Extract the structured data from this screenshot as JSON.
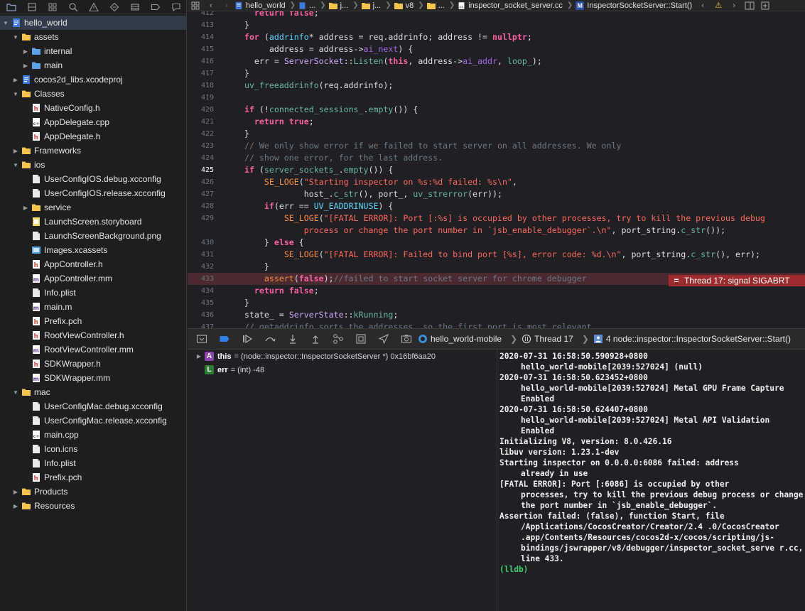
{
  "navigator": {
    "toolbar_icons": [
      "folder-icon",
      "source-control-icon",
      "symbol-icon",
      "find-icon",
      "issue-icon",
      "test-icon",
      "debug-icon",
      "breakpoint-icon",
      "report-icon"
    ],
    "tree": [
      {
        "label": "hello_world",
        "indent": 0,
        "icon": "project",
        "disclosure": "open",
        "selected": true
      },
      {
        "label": "assets",
        "indent": 1,
        "icon": "folder",
        "disclosure": "open"
      },
      {
        "label": "internal",
        "indent": 2,
        "icon": "folder-blue",
        "disclosure": "closed"
      },
      {
        "label": "main",
        "indent": 2,
        "icon": "folder-blue",
        "disclosure": "closed"
      },
      {
        "label": "cocos2d_libs.xcodeproj",
        "indent": 1,
        "icon": "project",
        "disclosure": "closed"
      },
      {
        "label": "Classes",
        "indent": 1,
        "icon": "folder",
        "disclosure": "open"
      },
      {
        "label": "NativeConfig.h",
        "indent": 2,
        "icon": "h"
      },
      {
        "label": "AppDelegate.cpp",
        "indent": 2,
        "icon": "cpp"
      },
      {
        "label": "AppDelegate.h",
        "indent": 2,
        "icon": "h"
      },
      {
        "label": "Frameworks",
        "indent": 1,
        "icon": "folder",
        "disclosure": "closed"
      },
      {
        "label": "ios",
        "indent": 1,
        "icon": "folder",
        "disclosure": "open"
      },
      {
        "label": "UserConfigIOS.debug.xcconfig",
        "indent": 2,
        "icon": "doc"
      },
      {
        "label": "UserConfigIOS.release.xcconfig",
        "indent": 2,
        "icon": "doc"
      },
      {
        "label": "service",
        "indent": 2,
        "icon": "folder",
        "disclosure": "closed"
      },
      {
        "label": "LaunchScreen.storyboard",
        "indent": 2,
        "icon": "storyboard"
      },
      {
        "label": "LaunchScreenBackground.png",
        "indent": 2,
        "icon": "doc"
      },
      {
        "label": "Images.xcassets",
        "indent": 2,
        "icon": "assets"
      },
      {
        "label": "AppController.h",
        "indent": 2,
        "icon": "h"
      },
      {
        "label": "AppController.mm",
        "indent": 2,
        "icon": "m"
      },
      {
        "label": "Info.plist",
        "indent": 2,
        "icon": "doc"
      },
      {
        "label": "main.m",
        "indent": 2,
        "icon": "m"
      },
      {
        "label": "Prefix.pch",
        "indent": 2,
        "icon": "h"
      },
      {
        "label": "RootViewController.h",
        "indent": 2,
        "icon": "h"
      },
      {
        "label": "RootViewController.mm",
        "indent": 2,
        "icon": "m"
      },
      {
        "label": "SDKWrapper.h",
        "indent": 2,
        "icon": "h"
      },
      {
        "label": "SDKWrapper.mm",
        "indent": 2,
        "icon": "m"
      },
      {
        "label": "mac",
        "indent": 1,
        "icon": "folder",
        "disclosure": "open"
      },
      {
        "label": "UserConfigMac.debug.xcconfig",
        "indent": 2,
        "icon": "doc"
      },
      {
        "label": "UserConfigMac.release.xcconfig",
        "indent": 2,
        "icon": "doc"
      },
      {
        "label": "main.cpp",
        "indent": 2,
        "icon": "cpp"
      },
      {
        "label": "Icon.icns",
        "indent": 2,
        "icon": "doc"
      },
      {
        "label": "Info.plist",
        "indent": 2,
        "icon": "doc"
      },
      {
        "label": "Prefix.pch",
        "indent": 2,
        "icon": "h"
      },
      {
        "label": "Products",
        "indent": 1,
        "icon": "folder",
        "disclosure": "closed"
      },
      {
        "label": "Resources",
        "indent": 1,
        "icon": "folder",
        "disclosure": "closed"
      }
    ]
  },
  "jumpbar": {
    "crumbs": [
      "hello_world",
      "...",
      "j...",
      "j...",
      "v8",
      "...",
      "inspector_socket_server.cc",
      "InspectorSocketServer::Start()"
    ],
    "method_badge": "M"
  },
  "editor": {
    "lines": [
      {
        "n": "412",
        "html": "    <span class=\"kw\">return</span> <span class=\"kw\">false</span>;"
      },
      {
        "n": "413",
        "html": "  }"
      },
      {
        "n": "414",
        "html": "  <span class=\"kw\">for</span> (<span class=\"type\">addrinfo</span>* address = req.addrinfo; address != <span class=\"kw\">nullptr</span>;"
      },
      {
        "n": "415",
        "html": "       address = address-><span class=\"mem\">ai_next</span>) {"
      },
      {
        "n": "416",
        "html": "    err = <span class=\"cls\">ServerSocket</span>::<span class=\"fn\">Listen</span>(<span class=\"kw\">this</span>, address-><span class=\"mem\">ai_addr</span>, <span class=\"fn\">loop_</span>);"
      },
      {
        "n": "417",
        "html": "  }"
      },
      {
        "n": "418",
        "html": "  <span class=\"fn\">uv_freeaddrinfo</span>(req.addrinfo);"
      },
      {
        "n": "419",
        "html": ""
      },
      {
        "n": "420",
        "html": "  <span class=\"kw\">if</span> (!<span class=\"fn\">connected_sessions_</span>.<span class=\"fn\">empty</span>()) {"
      },
      {
        "n": "421",
        "html": "    <span class=\"kw\">return</span> <span class=\"kw\">true</span>;"
      },
      {
        "n": "422",
        "html": "  }"
      },
      {
        "n": "423",
        "html": "  <span class=\"cmt\">// We only show error if we failed to start server on all addresses. We only</span>"
      },
      {
        "n": "424",
        "html": "  <span class=\"cmt\">// show one error, for the last address.</span>"
      },
      {
        "n": "425",
        "html": "  <span class=\"kw\">if</span> (<span class=\"fn\">server_sockets_</span>.<span class=\"fn\">empty</span>()) {",
        "current": true
      },
      {
        "n": "426",
        "html": "      <span class=\"macro\">SE_LOGE</span>(<span class=\"str\">\"Starting inspector on %s:%d failed: %s\\n\"</span>,"
      },
      {
        "n": "427",
        "html": "              host_.<span class=\"fn\">c_str</span>(), port_, <span class=\"fn\">uv_strerror</span>(err));"
      },
      {
        "n": "428",
        "html": "      <span class=\"kw\">if</span>(err == <span class=\"type\">UV_EADDRINUSE</span>) {"
      },
      {
        "n": "429",
        "html": "          <span class=\"macro\">SE_LOGE</span>(<span class=\"str\">\"[FATAL ERROR]: Port [:%s] is occupied by other processes, try to kill the previous debug</span>"
      },
      {
        "n": "",
        "html": "              <span class=\"str\">process or change the port number in `jsb_enable_debugger`.\\n\"</span>, port_string.<span class=\"fn\">c_str</span>());"
      },
      {
        "n": "430",
        "html": "      } <span class=\"kw\">else</span> {"
      },
      {
        "n": "431",
        "html": "          <span class=\"macro\">SE_LOGE</span>(<span class=\"str\">\"[FATAL ERROR]: Failed to bind port [%s], error code: %d.\\n\"</span>, port_string.<span class=\"fn\">c_str</span>(), err);"
      },
      {
        "n": "432",
        "html": "      }"
      },
      {
        "n": "433",
        "html": "      <span class=\"macro\">assert</span>(<span class=\"kw\">false</span>);<span class=\"cmt\">//failed to start socket server for chrome debugger</span>",
        "highlight": true
      },
      {
        "n": "434",
        "html": "    <span class=\"kw\">return</span> <span class=\"kw\">false</span>;"
      },
      {
        "n": "435",
        "html": "  }"
      },
      {
        "n": "436",
        "html": "  state_ = <span class=\"cls\">ServerState</span>::<span class=\"fn\">kRunning</span>;"
      },
      {
        "n": "437",
        "html": "  <span class=\"cmt\">// getaddrinfo sorts the addresses, so the first port is most relevant.</span>"
      }
    ],
    "signal_badge": "Thread 17: signal SIGABRT"
  },
  "debugbar": {
    "process": "hello_world-mobile",
    "thread": "Thread 17",
    "frame": "4 node::inspector::InspectorSocketServer::Start()"
  },
  "variables": [
    {
      "badge": "A",
      "badge_color": "#8e44ad",
      "name": "this",
      "value": "= (node::inspector::InspectorSocketServer *) 0x16bf6aa20",
      "expandable": true
    },
    {
      "badge": "L",
      "badge_color": "#2e7d32",
      "name": "err",
      "value": "= (int) -48",
      "expandable": false
    }
  ],
  "console": {
    "lines": [
      {
        "t": "2020-07-31 16:58:50.590928+0800",
        "indent": false
      },
      {
        "t": "hello_world-mobile[2039:527024] (null)",
        "indent": true
      },
      {
        "t": "2020-07-31 16:58:50.623452+0800",
        "indent": false
      },
      {
        "t": "hello_world-mobile[2039:527024] Metal GPU Frame Capture Enabled",
        "indent": true
      },
      {
        "t": "2020-07-31 16:58:50.624407+0800",
        "indent": false
      },
      {
        "t": "hello_world-mobile[2039:527024] Metal API Validation Enabled",
        "indent": true
      },
      {
        "t": "Initializing V8, version: 8.0.426.16",
        "indent": false
      },
      {
        "t": "libuv version: 1.23.1-dev",
        "indent": false
      },
      {
        "t": "Starting inspector on 0.0.0.0:6086 failed: address",
        "indent": false
      },
      {
        "t": "already in use",
        "indent": true
      },
      {
        "t": "[FATAL ERROR]: Port [:6086] is occupied by other",
        "indent": false
      },
      {
        "t": "processes, try to kill the previous debug process or change the port number in `jsb_enable_debugger`.",
        "indent": true
      },
      {
        "t": "Assertion failed: (false), function Start, file",
        "indent": false
      },
      {
        "t": "/Applications/CocosCreator/Creator/2.4 .0/CocosCreator .app/Contents/Resources/cocos2d-x/cocos/scripting/js-bindings/jswrapper/v8/debugger/inspector_socket_serve r.cc, line 433.",
        "indent": true
      }
    ],
    "prompt": "(lldb)"
  }
}
